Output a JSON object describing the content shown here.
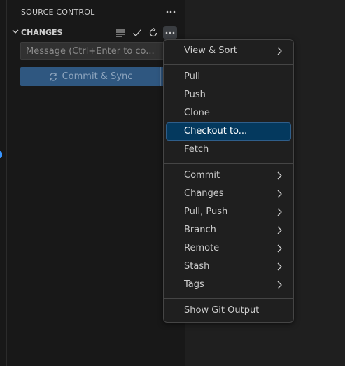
{
  "sidebar": {
    "title": "SOURCE CONTROL",
    "more_icon": "ellipsis-icon"
  },
  "changes": {
    "title": "CHANGES",
    "icons": [
      "list-view-icon",
      "check-icon",
      "refresh-icon",
      "ellipsis-icon"
    ]
  },
  "commit": {
    "message_placeholder": "Message (Ctrl+Enter to co...",
    "message_value": "",
    "button_label": "Commit & Sync",
    "button_icon": "sync-icon"
  },
  "menu": {
    "groups": [
      [
        {
          "label": "View & Sort",
          "submenu": true
        }
      ],
      [
        {
          "label": "Pull",
          "submenu": false
        },
        {
          "label": "Push",
          "submenu": false
        },
        {
          "label": "Clone",
          "submenu": false
        },
        {
          "label": "Checkout to...",
          "submenu": false,
          "selected": true
        },
        {
          "label": "Fetch",
          "submenu": false
        }
      ],
      [
        {
          "label": "Commit",
          "submenu": true
        },
        {
          "label": "Changes",
          "submenu": true
        },
        {
          "label": "Pull, Push",
          "submenu": true
        },
        {
          "label": "Branch",
          "submenu": true
        },
        {
          "label": "Remote",
          "submenu": true
        },
        {
          "label": "Stash",
          "submenu": true
        },
        {
          "label": "Tags",
          "submenu": true
        }
      ],
      [
        {
          "label": "Show Git Output",
          "submenu": false
        }
      ]
    ]
  },
  "colors": {
    "selection": "#04395e",
    "commit_button": "#2f5780",
    "menu_background": "#1f1f1f"
  }
}
